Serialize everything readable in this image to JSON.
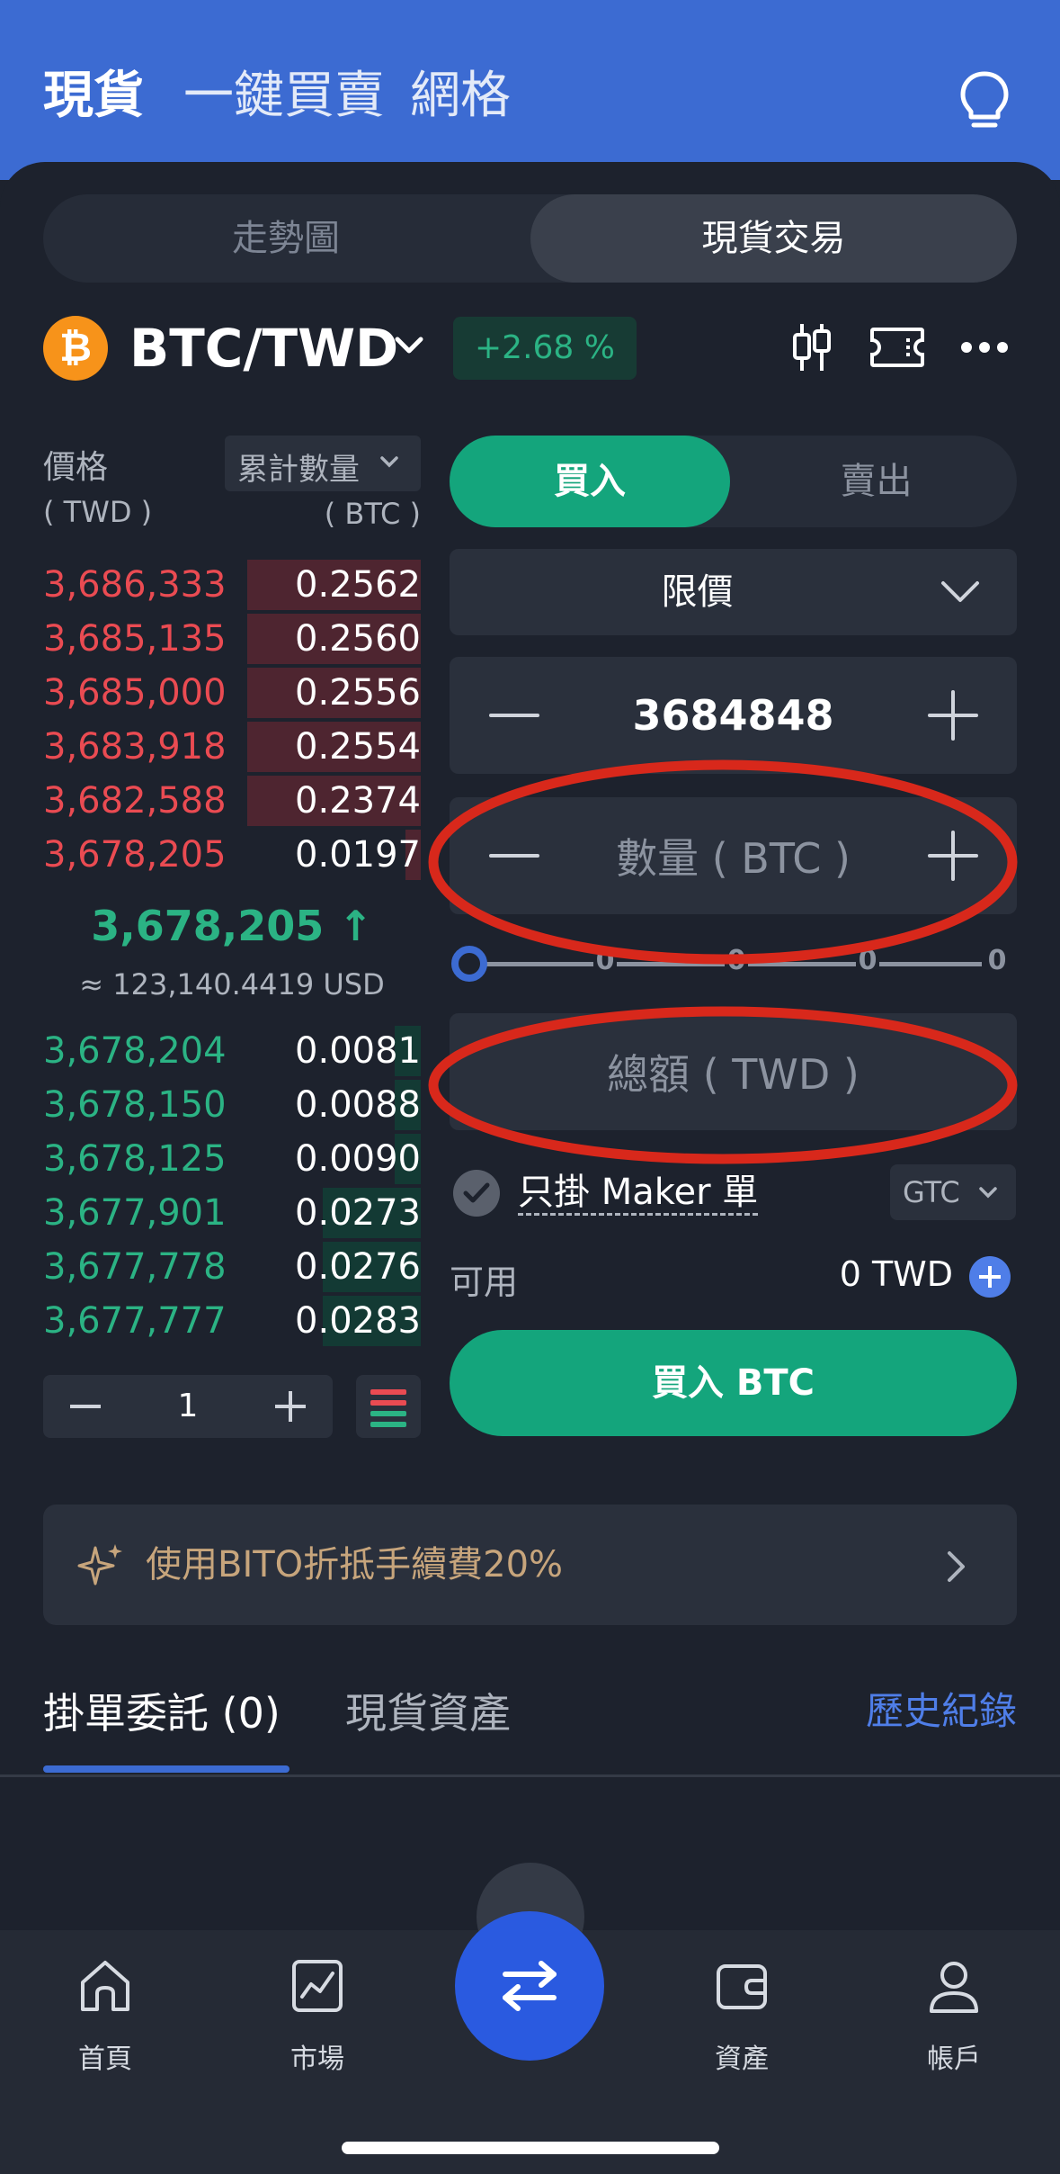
{
  "header": {
    "tabs": [
      "現貨",
      "一鍵買賣",
      "網格"
    ],
    "bulb_icon": "lightbulb-icon"
  },
  "view_switch": {
    "chart_label": "走勢圖",
    "trade_label": "現貨交易"
  },
  "pair": {
    "symbol_badge": "₿",
    "name": "BTC/TWD",
    "change": "+2.68 %",
    "change_color": "#2bb384"
  },
  "orderbook": {
    "price_label": "價格",
    "price_unit": "( TWD )",
    "qty_select": "累計數量",
    "qty_unit": "( BTC )",
    "asks": [
      {
        "price": "3,686,333",
        "qty": "0.2562",
        "depth": 0.46
      },
      {
        "price": "3,685,135",
        "qty": "0.2560",
        "depth": 0.46
      },
      {
        "price": "3,685,000",
        "qty": "0.2556",
        "depth": 0.46
      },
      {
        "price": "3,683,918",
        "qty": "0.2554",
        "depth": 0.46
      },
      {
        "price": "3,682,588",
        "qty": "0.2374",
        "depth": 0.46
      },
      {
        "price": "3,678,205",
        "qty": "0.0197",
        "depth": 0.04
      }
    ],
    "last_price": "3,678,205",
    "arrow": "↑",
    "usd_equiv": "≈ 123,140.4419 USD",
    "bids": [
      {
        "price": "3,678,204",
        "qty": "0.0081",
        "depth": 0.07
      },
      {
        "price": "3,678,150",
        "qty": "0.0088",
        "depth": 0.07
      },
      {
        "price": "3,678,125",
        "qty": "0.0090",
        "depth": 0.07
      },
      {
        "price": "3,677,901",
        "qty": "0.0273",
        "depth": 0.26
      },
      {
        "price": "3,677,778",
        "qty": "0.0276",
        "depth": 0.26
      },
      {
        "price": "3,677,777",
        "qty": "0.0283",
        "depth": 0.26
      }
    ],
    "precision": "1"
  },
  "form": {
    "buy_label": "買入",
    "sell_label": "賣出",
    "order_type": "限價",
    "price_value": "3684848",
    "qty_placeholder": "數量 ( BTC )",
    "slider_marks": [
      "0",
      "0",
      "0",
      "0"
    ],
    "total_placeholder": "總額 ( TWD )",
    "maker_label": "只掛 Maker 單",
    "tif": "GTC",
    "available_label": "可用",
    "available_value": "0 TWD",
    "submit_label": "買入 BTC"
  },
  "promo": {
    "text": "使用BITO折抵手續費20%"
  },
  "bottom_tabs": {
    "orders": "掛單委託 (0)",
    "assets": "現貨資產",
    "history": "歷史紀錄"
  },
  "nav": [
    {
      "label": "首頁",
      "icon": "home-icon"
    },
    {
      "label": "市場",
      "icon": "market-chart-icon"
    },
    {
      "label": "",
      "icon": "swap-arrows-icon"
    },
    {
      "label": "資產",
      "icon": "wallet-icon"
    },
    {
      "label": "帳戶",
      "icon": "user-icon"
    }
  ],
  "colors": {
    "accent": "#3c6bd2",
    "buy": "#14a57c",
    "ask": "#ea4b52",
    "bid": "#2bb384",
    "annotation": "#d8281b"
  }
}
